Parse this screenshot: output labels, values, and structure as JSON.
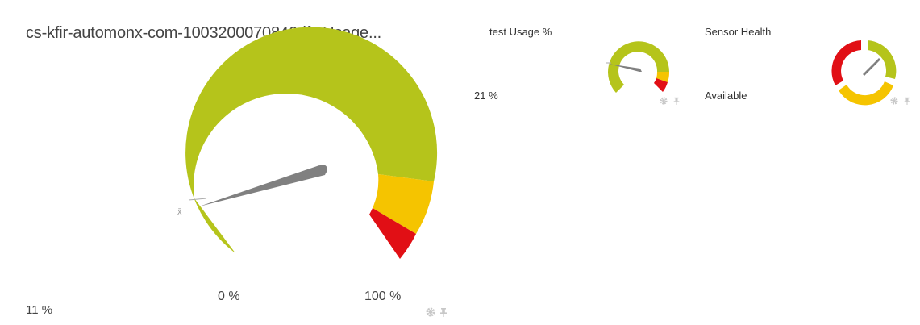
{
  "main_gauge": {
    "title": "cs-kfir-automonx-com-1003200070846dfc Usage...",
    "value_text": "11 %",
    "min_label": "0 %",
    "max_label": "100 %",
    "avg_marker": "x̄",
    "value_fraction": 0.11
  },
  "test_usage": {
    "title": "test Usage %",
    "value_text": "21 %",
    "value_fraction": 0.21
  },
  "sensor_health": {
    "title": "Sensor Health",
    "value_text": "Available"
  },
  "colors": {
    "ok": "#b5c41b",
    "warning": "#f5c400",
    "error": "#e10f15",
    "needle": "#808080",
    "icon": "#c8c8c8",
    "divider": "#d5d5d5"
  },
  "icons": [
    "gear-icon",
    "pin-icon"
  ]
}
